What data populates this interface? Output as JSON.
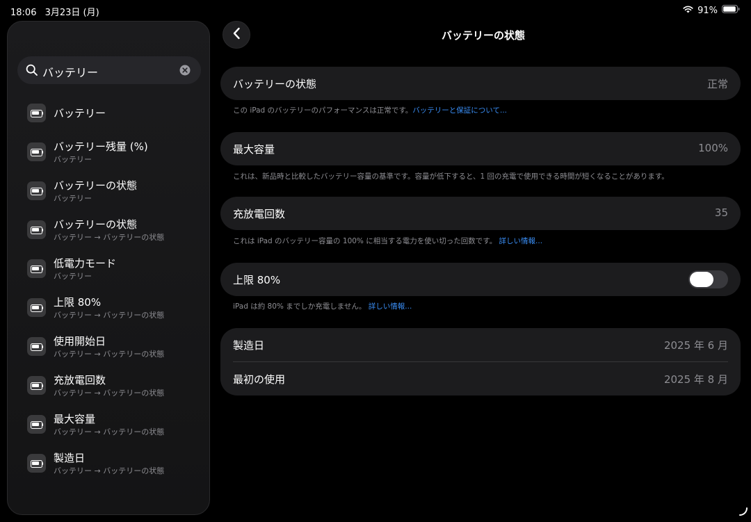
{
  "status": {
    "time": "18:06",
    "date": "3月23日 (月)",
    "battery_percent": "91%"
  },
  "sidebar": {
    "search": {
      "query": "バッテリー"
    },
    "results": [
      {
        "title": "バッテリー",
        "subtitle": ""
      },
      {
        "title": "バッテリー残量 (%)",
        "subtitle": "バッテリー"
      },
      {
        "title": "バッテリーの状態",
        "subtitle": "バッテリー"
      },
      {
        "title": "バッテリーの状態",
        "subtitle": "バッテリー → バッテリーの状態"
      },
      {
        "title": "低電力モード",
        "subtitle": "バッテリー"
      },
      {
        "title": "上限 80%",
        "subtitle": "バッテリー → バッテリーの状態"
      },
      {
        "title": "使用開始日",
        "subtitle": "バッテリー → バッテリーの状態"
      },
      {
        "title": "充放電回数",
        "subtitle": "バッテリー → バッテリーの状態"
      },
      {
        "title": "最大容量",
        "subtitle": "バッテリー → バッテリーの状態"
      },
      {
        "title": "製造日",
        "subtitle": "バッテリー → バッテリーの状態"
      }
    ]
  },
  "main": {
    "title": "バッテリーの状態",
    "health": {
      "label": "バッテリーの状態",
      "value": "正常",
      "note": "この iPad のバッテリーのパフォーマンスは正常です。",
      "link": "バッテリーと保証について..."
    },
    "max_capacity": {
      "label": "最大容量",
      "value": "100%",
      "note": "これは、新品時と比較したバッテリー容量の基準です。容量が低下すると、1 回の充電で使用できる時間が短くなることがあります。"
    },
    "cycle_count": {
      "label": "充放電回数",
      "value": "35",
      "note": "これは iPad のバッテリー容量の 100% に相当する電力を使い切った回数です。",
      "link": "詳しい情報..."
    },
    "limit": {
      "label": "上限 80%",
      "enabled": false,
      "note": "iPad は約 80% までしか充電しません。",
      "link": "詳しい情報..."
    },
    "dates": [
      {
        "label": "製造日",
        "value": "2025 年 6 月"
      },
      {
        "label": "最初の使用",
        "value": "2025 年 8 月"
      }
    ]
  },
  "colors": {
    "accent": "#3a8ef6",
    "card": "#1c1c1e",
    "secondary_text": "#8e8e93"
  }
}
